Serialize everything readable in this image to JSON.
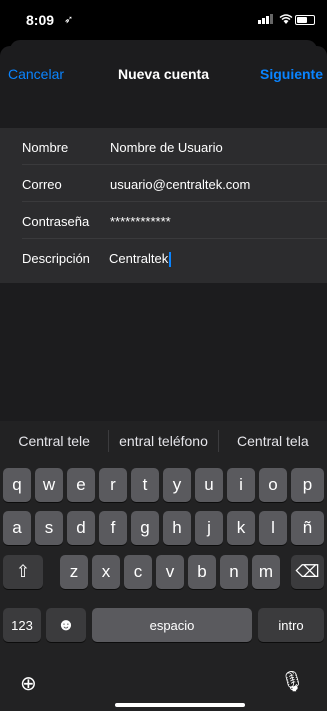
{
  "status_bar": {
    "time": "8:09",
    "location_glyph": "➶"
  },
  "nav": {
    "cancel": "Cancelar",
    "title": "Nueva cuenta",
    "next": "Siguiente"
  },
  "form": {
    "rows": [
      {
        "label": "Nombre",
        "value": "Nombre de Usuario"
      },
      {
        "label": "Correo",
        "value": "usuario@centraltek.com"
      },
      {
        "label": "Contraseña",
        "value": "************"
      },
      {
        "label": "Descripción",
        "value": "Centraltek"
      }
    ]
  },
  "keyboard": {
    "suggestions": [
      "Central tele",
      "entral teléfono",
      "Central tela"
    ],
    "row1": [
      "q",
      "w",
      "e",
      "r",
      "t",
      "y",
      "u",
      "i",
      "o",
      "p"
    ],
    "row2": [
      "a",
      "s",
      "d",
      "f",
      "g",
      "h",
      "j",
      "k",
      "l",
      "ñ"
    ],
    "row3": [
      "z",
      "x",
      "c",
      "v",
      "b",
      "n",
      "m"
    ],
    "shift": "⇧",
    "backspace": "⌫",
    "numbers": "123",
    "emoji": "☻",
    "space": "espacio",
    "return": "intro",
    "globe": "⊕",
    "mic": "🎙"
  },
  "colors": {
    "accent": "#0a84ff",
    "background": "#000000",
    "sheet": "#1c1c1e",
    "form": "#2c2c2e"
  }
}
